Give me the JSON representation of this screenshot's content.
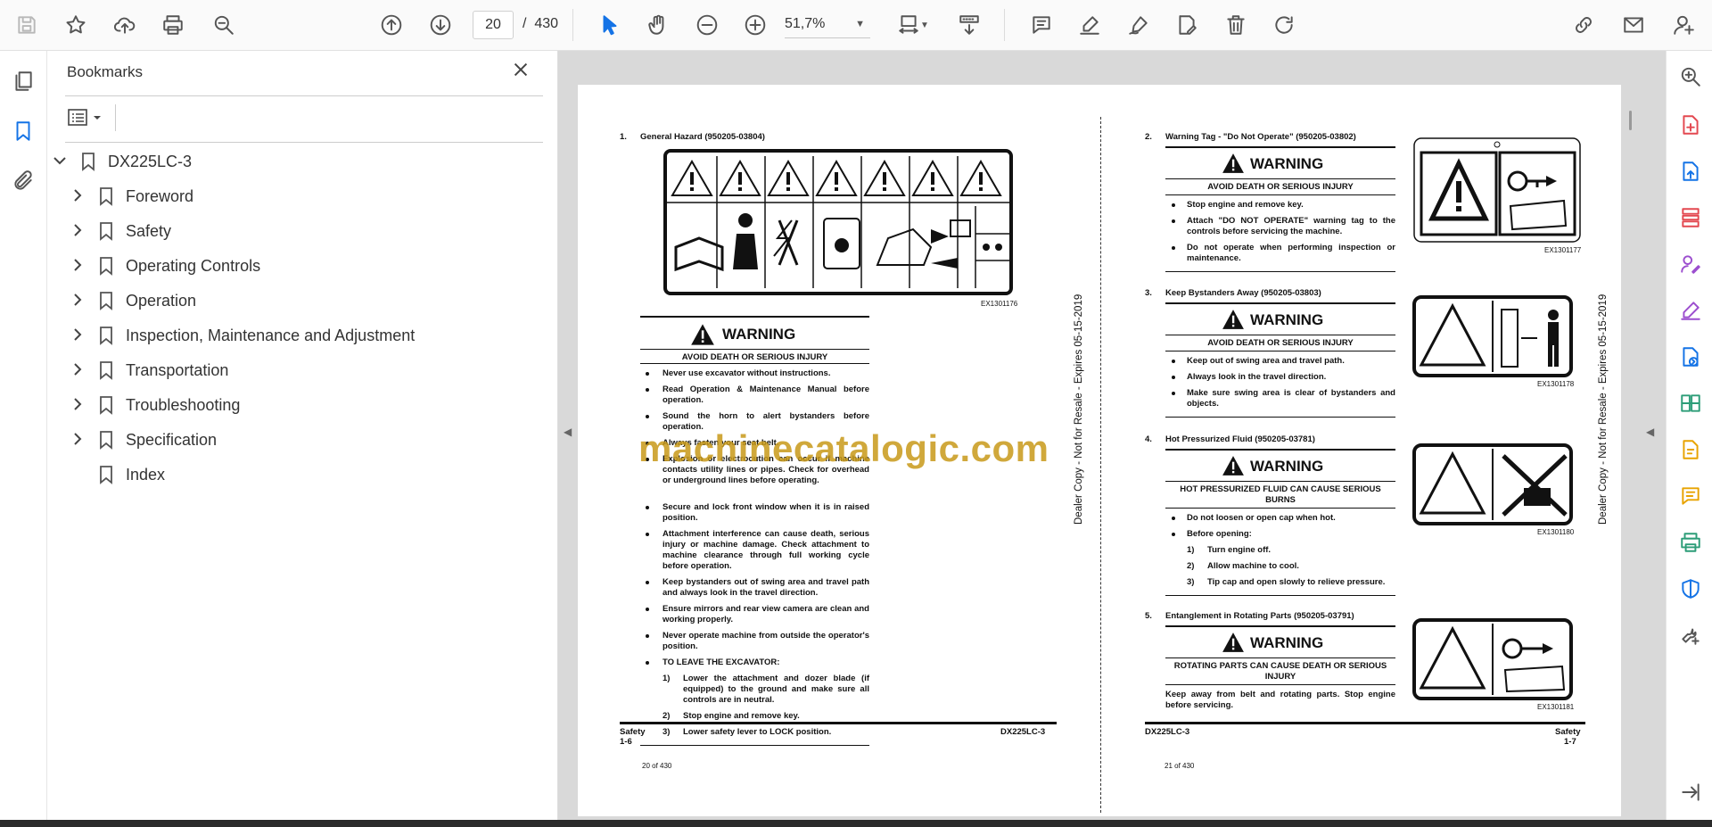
{
  "toolbar": {
    "page_current": "20",
    "page_separator": "/",
    "page_total": "430",
    "zoom": "51,7%"
  },
  "panel": {
    "title": "Bookmarks",
    "root": "DX225LC-3",
    "items": [
      "Foreword",
      "Safety",
      "Operating Controls",
      "Operation",
      "Inspection, Maintenance and Adjustment",
      "Transportation",
      "Troubleshooting",
      "Specification",
      "Index"
    ]
  },
  "left_page": {
    "heading_num": "1.",
    "heading": "General Hazard (950205-03804)",
    "fig_id": "EX1301176",
    "warning": "WARNING",
    "subhead": "AVOID DEATH OR SERIOUS INJURY",
    "bullets": [
      "Never use excavator without instructions.",
      "Read Operation & Maintenance Manual before operation.",
      "Sound the horn to alert bystanders before operation.",
      "Always fasten your seat belt.",
      "Explosion or electrocution can occur if machine contacts utility lines or pipes. Check for overhead or underground lines before operating.",
      "Secure and lock front window when it is in raised position.",
      "Attachment interference can cause death, serious injury or machine damage. Check attachment to machine clearance through full working cycle before operation.",
      "Keep bystanders out of swing area and travel path and always look in the travel direction.",
      "Ensure mirrors and rear view camera are clean and working properly.",
      "Never operate machine from outside the operator's position.",
      "TO LEAVE THE EXCAVATOR:"
    ],
    "steps": [
      {
        "n": "1)",
        "t": "Lower the attachment and dozer blade (if equipped) to the ground and make sure all controls are in neutral."
      },
      {
        "n": "2)",
        "t": "Stop engine and remove key."
      },
      {
        "n": "3)",
        "t": "Lower safety lever to LOCK position."
      }
    ],
    "footer_left": "Safety",
    "footer_right": "DX225LC-3",
    "footer_page": "1-6",
    "page_of": "20 of 430"
  },
  "right_page": {
    "sections": [
      {
        "num": "2.",
        "title": "Warning Tag - \"Do Not Operate\" (950205-03802)",
        "warning": "WARNING",
        "subhead": "AVOID DEATH OR SERIOUS INJURY",
        "bullets": [
          "Stop engine and remove key.",
          "Attach \"DO NOT OPERATE\" warning tag to the controls before servicing the machine.",
          "Do not operate when performing inspection or maintenance."
        ],
        "fig_id": "EX1301177"
      },
      {
        "num": "3.",
        "title": "Keep Bystanders Away (950205-03803)",
        "warning": "WARNING",
        "subhead": "AVOID DEATH OR SERIOUS INJURY",
        "bullets": [
          "Keep out of swing area and travel path.",
          "Always look in the travel direction.",
          "Make sure swing area is clear of bystanders and objects."
        ],
        "fig_id": "EX1301178"
      },
      {
        "num": "4.",
        "title": "Hot Pressurized Fluid (950205-03781)",
        "warning": "WARNING",
        "subhead": "HOT PRESSURIZED FLUID CAN CAUSE SERIOUS BURNS",
        "bullets": [
          "Do not loosen or open cap when hot.",
          "Before opening:"
        ],
        "steps": [
          {
            "n": "1)",
            "t": "Turn engine off."
          },
          {
            "n": "2)",
            "t": "Allow machine to cool."
          },
          {
            "n": "3)",
            "t": "Tip cap and open slowly to relieve pressure."
          }
        ],
        "fig_id": "EX1301180"
      },
      {
        "num": "5.",
        "title": "Entanglement in Rotating Parts (950205-03791)",
        "warning": "WARNING",
        "subhead": "ROTATING PARTS CAN CAUSE DEATH OR SERIOUS INJURY",
        "body": "Keep away from belt and rotating parts. Stop engine before servicing.",
        "fig_id": "EX1301181"
      }
    ],
    "footer_left": "DX225LC-3",
    "footer_right": "Safety",
    "footer_page": "1-7",
    "page_of": "21 of 430"
  },
  "vertical_note": "Dealer Copy - Not for Resale - Expires 05-15-2019",
  "watermark": "machinecatalogic.com",
  "colors": {
    "accent": "#1473e6",
    "watermark": "#c89a1a"
  }
}
